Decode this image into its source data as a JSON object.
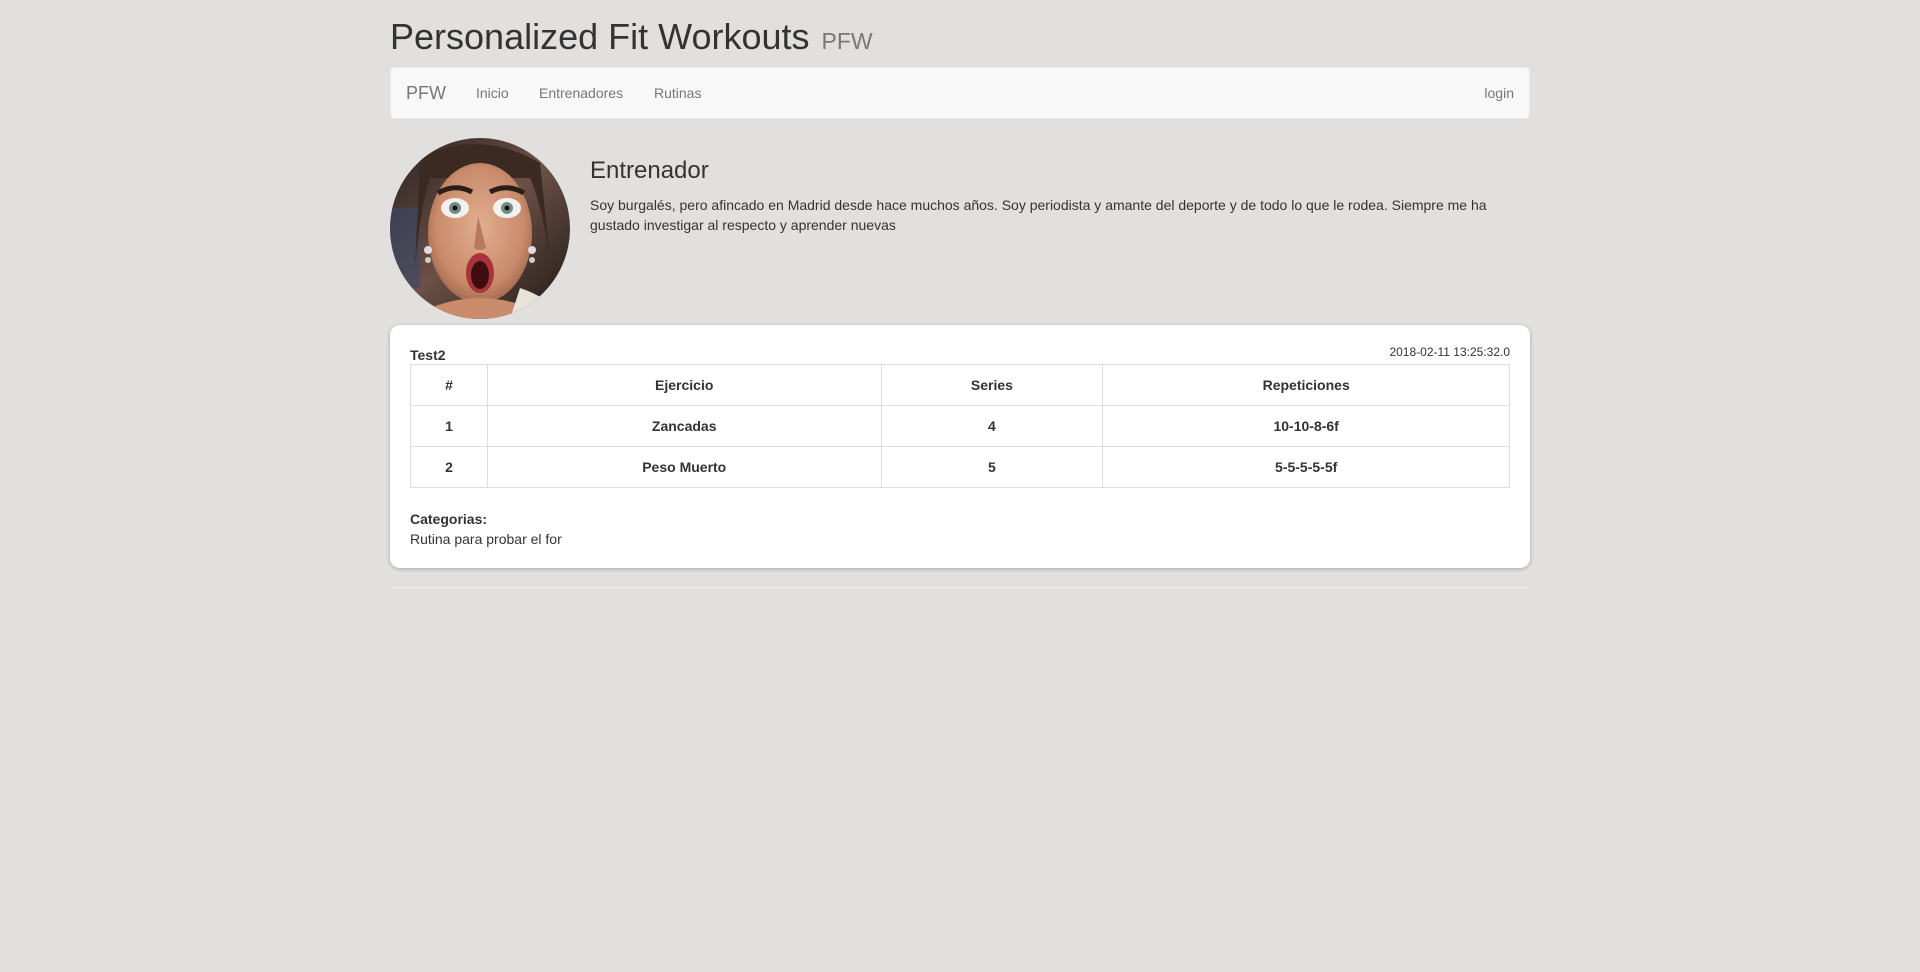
{
  "header": {
    "title": "Personalized Fit Workouts",
    "subtitle": "PFW"
  },
  "navbar": {
    "brand": "PFW",
    "links": [
      "Inicio",
      "Entrenadores",
      "Rutinas"
    ],
    "login": "login"
  },
  "profile": {
    "heading": "Entrenador",
    "bio": "Soy burgalés, pero afincado en Madrid desde hace muchos años. Soy periodista y amante del deporte y de todo lo que le rodea. Siempre me ha gustado investigar al respecto y aprender nuevas"
  },
  "routine": {
    "name": "Test2",
    "date": "2018-02-11 13:25:32.0",
    "columns": [
      "#",
      "Ejercicio",
      "Series",
      "Repeticiones"
    ],
    "rows": [
      [
        "1",
        "Zancadas",
        "4",
        "10-10-8-6f"
      ],
      [
        "2",
        "Peso Muerto",
        "5",
        "5-5-5-5-5f"
      ]
    ],
    "categories_label": "Categorias:",
    "categories_text": "Rutina para probar el for"
  }
}
